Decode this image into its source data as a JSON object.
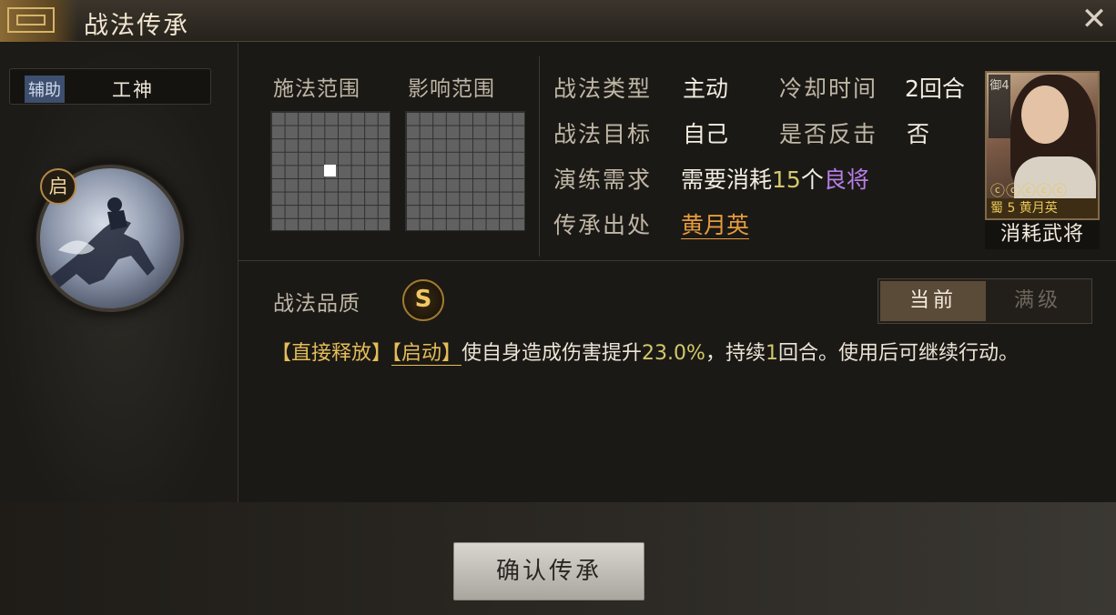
{
  "window": {
    "title": "战法传承",
    "close_icon": "close-icon"
  },
  "left": {
    "tag_label": "辅助",
    "tag_value": "工神",
    "badge": "启"
  },
  "ranges": {
    "cast_label": "施法范围",
    "effect_label": "影响范围"
  },
  "info": {
    "type_key": "战法类型",
    "type_value": "主动",
    "cooldown_key": "冷却时间",
    "cooldown_value": "2回合",
    "target_key": "战法目标",
    "target_value": "自己",
    "counter_key": "是否反击",
    "counter_value": "否",
    "req_key": "演练需求",
    "req_prefix": "需要消耗",
    "req_count": "15",
    "req_unit": "个",
    "req_grade": "良将",
    "source_key": "传承出处",
    "source_value": "黄月英"
  },
  "card": {
    "side_tag": "御4",
    "stars": "ⓒⓒⓒⓒⓒ",
    "footer": "蜀 5  黄月英",
    "caption": "消耗武将"
  },
  "quality": {
    "label": "战法品质",
    "grade": "S"
  },
  "toggle": {
    "current": "当前",
    "max": "满级"
  },
  "description": {
    "tag1": "【直接释放】",
    "tag2": "【启动】",
    "part1": "使自身造成伤害提升",
    "percent": "23.0%",
    "part2": "，持续",
    "turns": "1",
    "part3": "回合。使用后可继续行动。"
  },
  "actions": {
    "confirm": "确认传承"
  },
  "colors": {
    "accent_gold": "#e4bd59",
    "link_orange": "#e69b3e",
    "purple": "#b77ee6"
  }
}
